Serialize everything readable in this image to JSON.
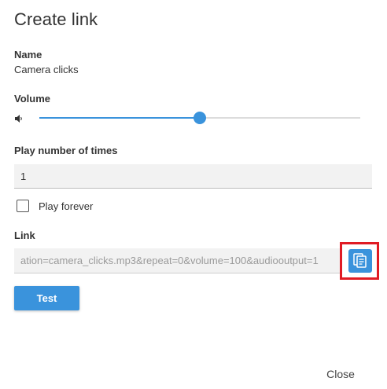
{
  "dialog": {
    "title": "Create link"
  },
  "name": {
    "label": "Name",
    "value": "Camera clicks"
  },
  "volume": {
    "label": "Volume",
    "icon": "speaker-icon",
    "level_fraction": 0.5
  },
  "play_count": {
    "label": "Play number of times",
    "value": "1"
  },
  "play_forever": {
    "label": "Play forever",
    "checked": false
  },
  "link": {
    "label": "Link",
    "value": "ation=camera_clicks.mp3&repeat=0&volume=100&audiooutput=1",
    "copy_icon": "copy-icon"
  },
  "actions": {
    "test_label": "Test",
    "close_label": "Close"
  },
  "colors": {
    "accent": "#3a93dc",
    "highlight": "#e01b24"
  }
}
